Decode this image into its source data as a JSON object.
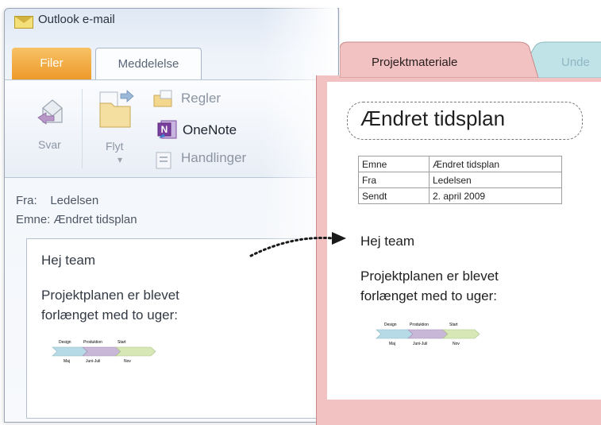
{
  "outlook": {
    "title": "Outlook e-mail",
    "tabs": [
      {
        "label": "Filer"
      },
      {
        "label": "Meddelelse"
      }
    ],
    "ribbon": {
      "reply_label": "Svar",
      "move_label": "Flyt",
      "rules_label": "Regler",
      "onenote_label": "OneNote",
      "actions_label": "Handlinger"
    },
    "header": {
      "from_label": "Fra:",
      "from_value": "Ledelsen",
      "subject_label": "Emne:",
      "subject_value": "Ændret tidsplan"
    },
    "body": {
      "greeting": "Hej team",
      "line1": "Projektplanen er blevet",
      "line2": "forlænget med to uger:"
    },
    "timeline": {
      "phases": [
        "Design",
        "Produktion",
        "Start"
      ],
      "months": [
        "Maj",
        "Juni-Juli",
        "Nov"
      ],
      "colors": [
        "#b7dbe6",
        "#c9b7d8",
        "#d7e8b6"
      ]
    }
  },
  "onenote": {
    "tabs": [
      {
        "label": "Projektmateriale",
        "color": "#f2c1c1"
      },
      {
        "label": "Unde",
        "color": "#bfe3e6"
      }
    ],
    "page_title": "Ændret tidsplan",
    "table": [
      {
        "key": "Emne",
        "value": "Ændret tidsplan"
      },
      {
        "key": "Fra",
        "value": "Ledelsen"
      },
      {
        "key": "Sendt",
        "value": "2. april 2009"
      }
    ],
    "body": {
      "greeting": "Hej team",
      "line1": "Projektplanen er blevet",
      "line2": "forlænget med to uger:"
    },
    "timeline": {
      "phases": [
        "Design",
        "Produktion",
        "Start"
      ],
      "months": [
        "Maj",
        "Juni-Juli",
        "Nov"
      ]
    }
  },
  "icons": [
    "envelope-icon",
    "reply-icon",
    "move-icon",
    "rules-icon",
    "onenote-icon",
    "actions-icon",
    "arrow-icon"
  ]
}
